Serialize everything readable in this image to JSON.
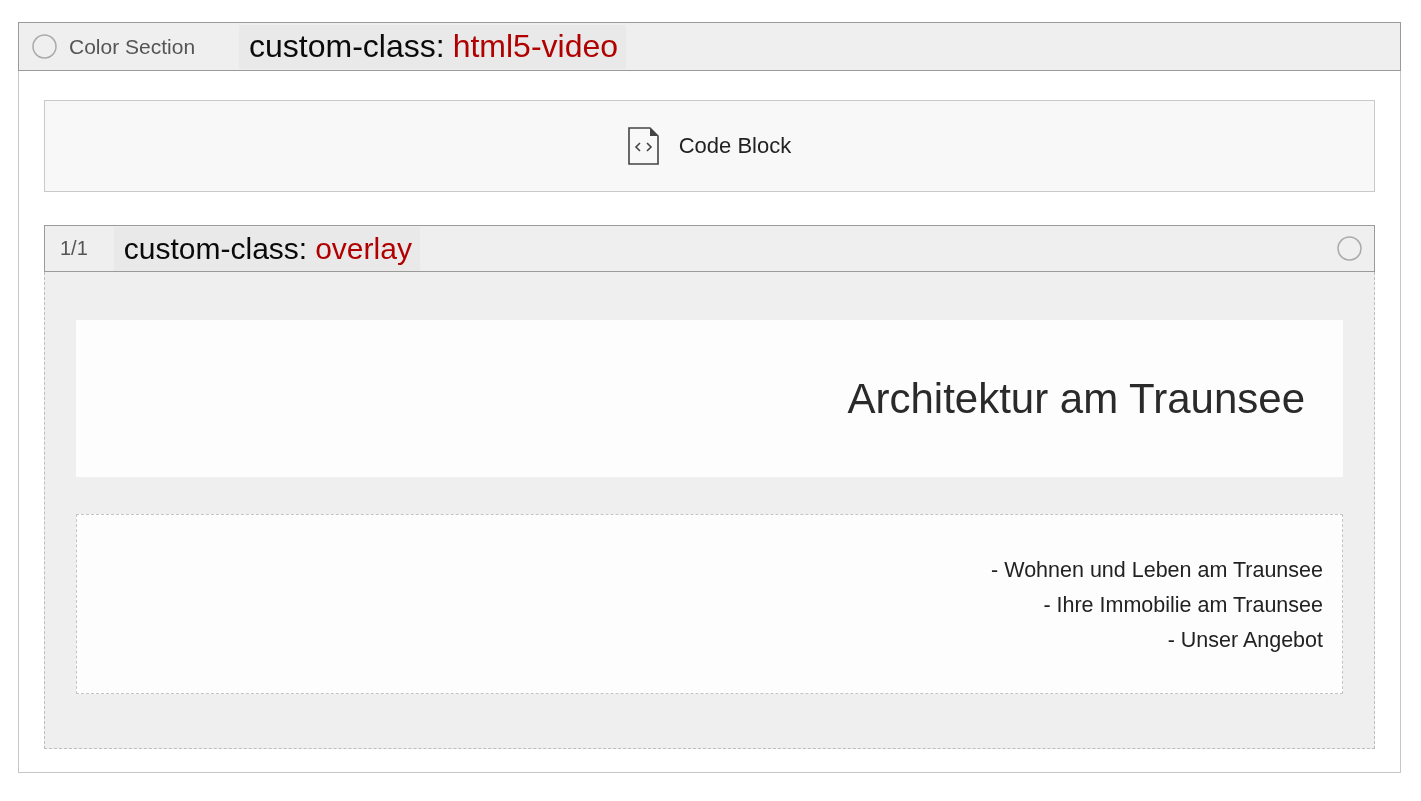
{
  "section": {
    "selected": false,
    "label": "Color Section",
    "annotation": {
      "key": "custom-class:",
      "value": "html5-video"
    }
  },
  "code_block": {
    "label": "Code Block"
  },
  "row": {
    "count": "1/1",
    "selected": false,
    "annotation": {
      "key": "custom-class:",
      "value": "overlay"
    }
  },
  "heading": "Architektur am Traunsee",
  "links": [
    "- Wohnen und Leben am Traunsee",
    "- Ihre Immobilie am Traunsee",
    "- Unser Angebot"
  ]
}
